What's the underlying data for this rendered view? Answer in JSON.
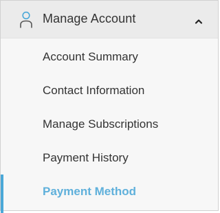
{
  "menu": {
    "header": {
      "title": "Manage Account",
      "icon": "user-icon",
      "toggle_icon": "chevron-up-icon",
      "expanded": true
    },
    "items": [
      {
        "label": "Account Summary",
        "active": false
      },
      {
        "label": "Contact Information",
        "active": false
      },
      {
        "label": "Manage Subscriptions",
        "active": false
      },
      {
        "label": "Payment History",
        "active": false
      },
      {
        "label": "Payment Method",
        "active": true
      }
    ]
  },
  "colors": {
    "accent": "#4aa8d8",
    "active_text": "#5fb0db",
    "text": "#333333",
    "header_bg": "#ebebeb",
    "panel_bg": "#f7f7f7"
  }
}
